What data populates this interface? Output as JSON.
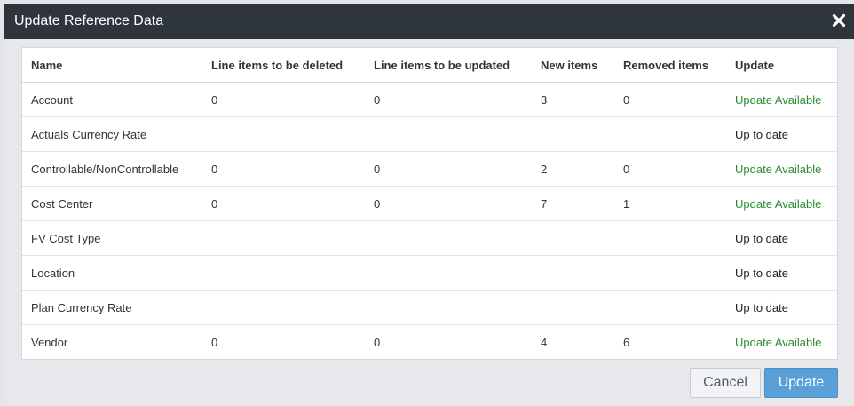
{
  "dialog": {
    "title": "Update Reference Data"
  },
  "table": {
    "columns": [
      "Name",
      "Line items to be deleted",
      "Line items to be updated",
      "New items",
      "Removed items",
      "Update"
    ],
    "rows": [
      {
        "name": "Account",
        "deleted": "0",
        "updated": "0",
        "new_items": "3",
        "removed": "0",
        "status": "Update Available",
        "status_type": "available"
      },
      {
        "name": "Actuals Currency Rate",
        "deleted": "",
        "updated": "",
        "new_items": "",
        "removed": "",
        "status": "Up to date",
        "status_type": "uptodate"
      },
      {
        "name": "Controllable/NonControllable",
        "deleted": "0",
        "updated": "0",
        "new_items": "2",
        "removed": "0",
        "status": "Update Available",
        "status_type": "available"
      },
      {
        "name": "Cost Center",
        "deleted": "0",
        "updated": "0",
        "new_items": "7",
        "removed": "1",
        "status": "Update Available",
        "status_type": "available"
      },
      {
        "name": "FV Cost Type",
        "deleted": "",
        "updated": "",
        "new_items": "",
        "removed": "",
        "status": "Up to date",
        "status_type": "uptodate"
      },
      {
        "name": "Location",
        "deleted": "",
        "updated": "",
        "new_items": "",
        "removed": "",
        "status": "Up to date",
        "status_type": "uptodate"
      },
      {
        "name": "Plan Currency Rate",
        "deleted": "",
        "updated": "",
        "new_items": "",
        "removed": "",
        "status": "Up to date",
        "status_type": "uptodate"
      },
      {
        "name": "Vendor",
        "deleted": "0",
        "updated": "0",
        "new_items": "4",
        "removed": "6",
        "status": "Update Available",
        "status_type": "available"
      }
    ]
  },
  "footer": {
    "cancel_label": "Cancel",
    "update_label": "Update"
  },
  "colors": {
    "header_bg": "#2f353d",
    "update_available": "#2e8b2e",
    "primary_button": "#5aa0d8"
  },
  "icons": {
    "close": "close-icon"
  }
}
